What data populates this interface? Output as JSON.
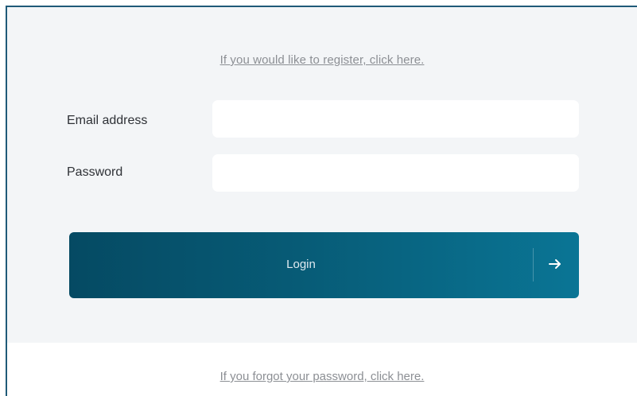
{
  "links": {
    "register": "If you would like to register, click here.",
    "forgot_password": "If you forgot your password, click here."
  },
  "form": {
    "email_label": "Email address",
    "email_value": "",
    "password_label": "Password",
    "password_value": ""
  },
  "login_button": {
    "label": "Login",
    "icon": "arrow-right-icon"
  },
  "colors": {
    "border": "#1f5a78",
    "form_background": "#f3f5f7",
    "button_gradient_start": "#054a63",
    "button_gradient_end": "#0a7595",
    "link_text": "#8c8f94"
  }
}
